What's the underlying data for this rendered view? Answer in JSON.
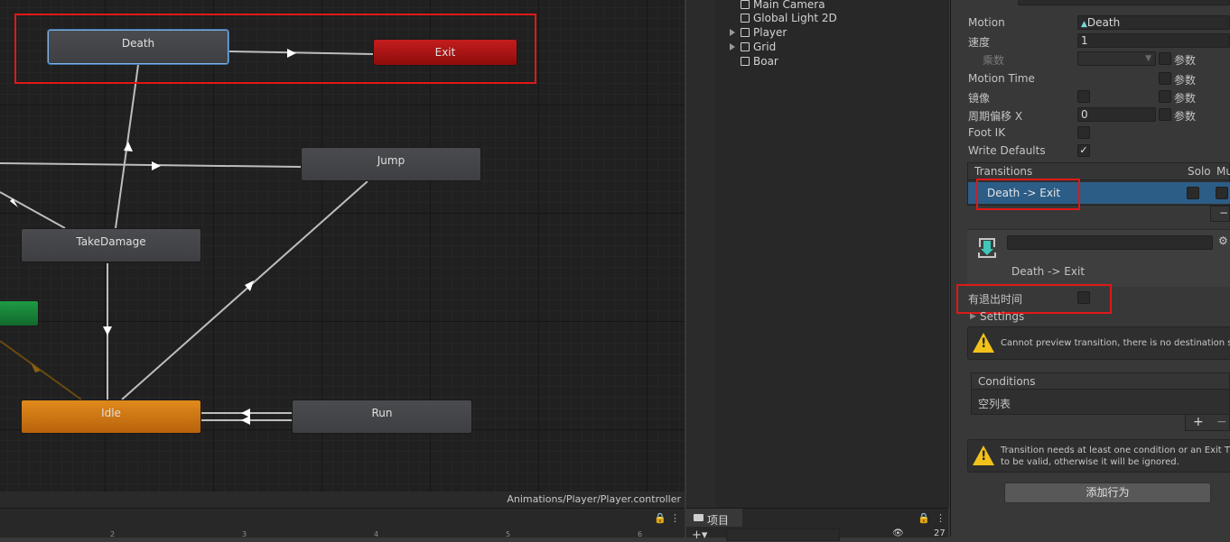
{
  "graph": {
    "states": {
      "death": "Death",
      "exit": "Exit",
      "jump": "Jump",
      "take_damage": "TakeDamage",
      "idle": "Idle",
      "run": "Run"
    },
    "controller_path": "Animations/Player/Player.controller"
  },
  "timeline": {
    "ticks": [
      "2",
      "3",
      "4",
      "5",
      "6"
    ]
  },
  "hierarchy": {
    "items": [
      "Main Camera",
      "Global Light 2D",
      "Player",
      "Grid",
      "Boar"
    ]
  },
  "project": {
    "tab": "项目",
    "search_value": "",
    "count": "27"
  },
  "inspector": {
    "motion_label": "Motion",
    "motion_value": "Death",
    "speed_label": "速度",
    "speed_value": "1",
    "multiplier_label": "乘数",
    "param_label": "参数",
    "motion_time_label": "Motion Time",
    "mirror_label": "镜像",
    "cycle_offset_label": "周期偏移 X",
    "cycle_offset_value": "0",
    "foot_ik_label": "Foot IK",
    "write_defaults_label": "Write Defaults",
    "transitions_header": "Transitions",
    "solo_label": "Solo",
    "mute_label": "Mu",
    "transition_item": "Death -> Exit",
    "transition_title": "Death -> Exit",
    "transition_name_value": "",
    "has_exit_time_label": "有退出时间",
    "settings_label": "Settings",
    "preview_warning": "Cannot preview transition, there is no destination st",
    "conditions_header": "Conditions",
    "conditions_empty": "空列表",
    "condition_warning_line1": "Transition needs at least one condition or an Exit Tir",
    "condition_warning_line2": "to be valid, otherwise it will be ignored.",
    "add_behaviour": "添加行为",
    "colors": {
      "selected_row": "#2c5d87",
      "highlight": "#e01818"
    }
  }
}
